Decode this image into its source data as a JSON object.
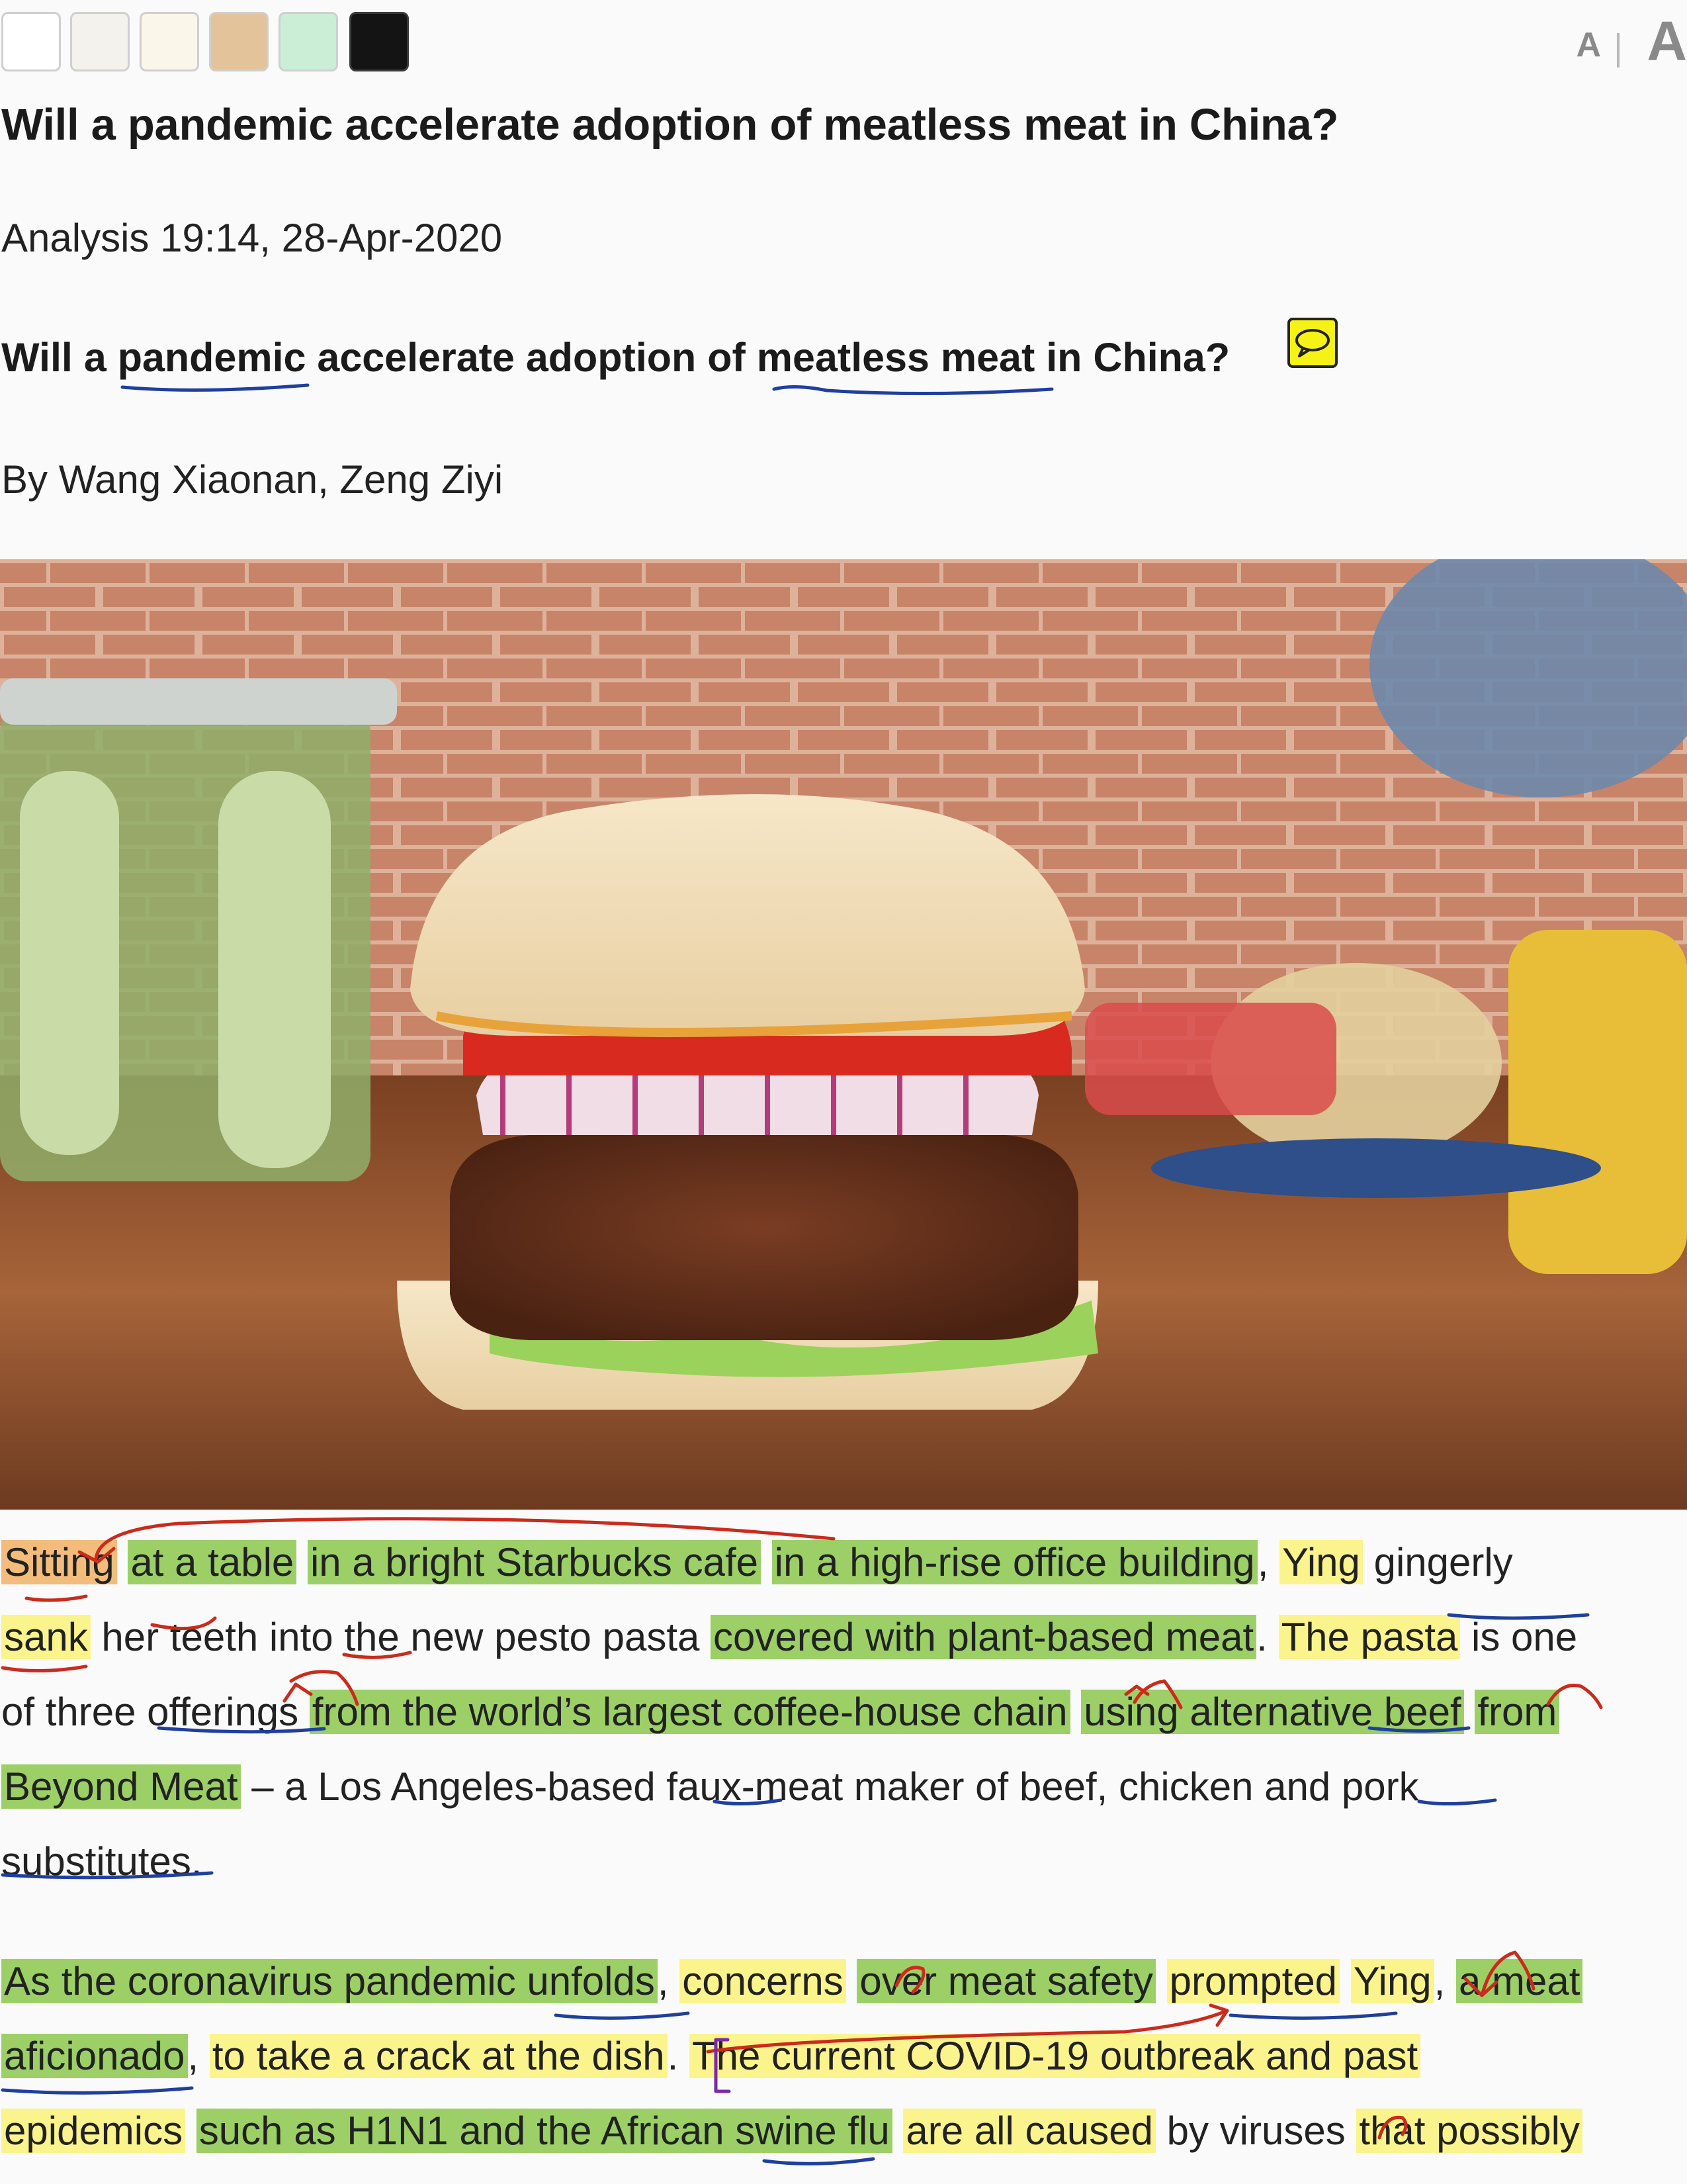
{
  "toolbar": {
    "themes": [
      {
        "name": "white",
        "color": "#ffffff"
      },
      {
        "name": "paper",
        "color": "#f4f2ec"
      },
      {
        "name": "cream",
        "color": "#fbf6ea"
      },
      {
        "name": "tan",
        "color": "#e3c49a"
      },
      {
        "name": "mint",
        "color": "#cbeed6"
      },
      {
        "name": "black",
        "color": "#141414"
      }
    ],
    "font_small_label": "A",
    "font_large_label": "A"
  },
  "article": {
    "title": "Will a pandemic accelerate adoption of meatless meat in China?",
    "meta": "Analysis 19:14, 28-Apr-2020",
    "subtitle": {
      "p1": "Will a ",
      "w1": "pandemic",
      "p2": " accelerate adoption of ",
      "w2": "meatless meat",
      "p3": " in China?"
    },
    "byline": "By Wang Xiaonan, Zeng Ziyi"
  },
  "paragraph1": {
    "l1": [
      "Sitting",
      " ",
      "at a table",
      " ",
      "in a bright Starbucks cafe",
      " ",
      "in a high-rise office building",
      ", ",
      "Ying",
      " gingerly"
    ],
    "l2": [
      "sank",
      " her teeth into the new pesto pasta ",
      "covered with plant-based meat",
      ". ",
      "The pasta",
      " is one"
    ],
    "l3": [
      "of three offerings ",
      "from the world’s largest coffee-house chain",
      " ",
      "using alternative beef",
      " ",
      "from"
    ],
    "l4": [
      "Beyond Meat",
      " – a Los Angeles-based faux-meat maker of beef, chicken and pork"
    ],
    "l5": [
      "substitutes."
    ]
  },
  "paragraph2": {
    "l1": [
      "As the coronavirus pandemic unfolds",
      ", ",
      "concerns",
      " ",
      "over meat safety",
      " ",
      "prompted",
      " ",
      "Ying",
      ", ",
      "a meat"
    ],
    "l2": [
      "aficionado",
      ", ",
      "to take a crack at the dish",
      ". ",
      "The current COVID-19 outbreak and past"
    ],
    "l3": [
      "epidemics",
      " ",
      "such as H1N1 and the African swine flu",
      " ",
      "are all caused",
      " by viruses ",
      "that possibly"
    ]
  },
  "colors": {
    "highlight_green": "#9cd067",
    "highlight_yellow": "#fbf48c",
    "highlight_orange": "#f3bc7a",
    "annotation_blue": "#1f3fa0",
    "annotation_red": "#cc2a1a",
    "annotation_purple": "#7a2aa8"
  }
}
